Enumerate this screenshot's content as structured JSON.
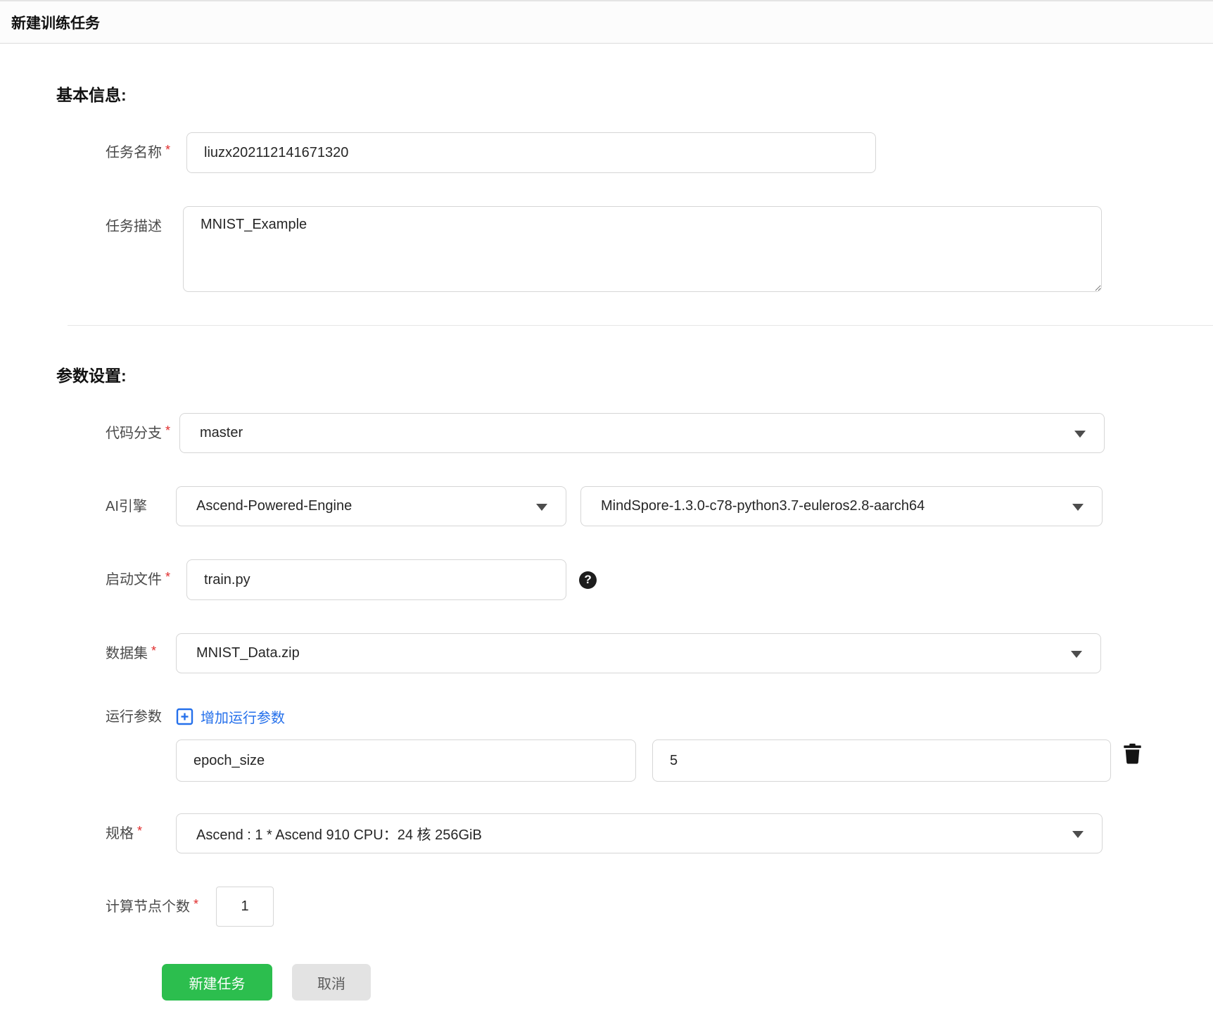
{
  "header": {
    "title": "新建训练任务"
  },
  "basic_section": {
    "heading": "基本信息:",
    "task_name": {
      "label": "任务名称",
      "required_mark": "*",
      "value": "liuzx202112141671320"
    },
    "task_desc": {
      "label": "任务描述",
      "value": "MNIST_Example"
    }
  },
  "params_section": {
    "heading": "参数设置:",
    "code_branch": {
      "label": "代码分支",
      "required_mark": "*",
      "value": "master"
    },
    "ai_engine": {
      "label": "AI引擎",
      "engine": "Ascend-Powered-Engine",
      "version": "MindSpore-1.3.0-c78-python3.7-euleros2.8-aarch64"
    },
    "boot_file": {
      "label": "启动文件",
      "required_mark": "*",
      "value": "train.py",
      "help_glyph": "?"
    },
    "dataset": {
      "label": "数据集",
      "required_mark": "*",
      "value": "MNIST_Data.zip"
    },
    "run_params": {
      "label": "运行参数",
      "add_label": "增加运行参数",
      "rows": [
        {
          "key": "epoch_size",
          "value": "5"
        }
      ]
    },
    "spec": {
      "label": "规格",
      "required_mark": "*",
      "value": "Ascend : 1 * Ascend 910 CPU：24 核 256GiB"
    },
    "node_count": {
      "label": "计算节点个数",
      "required_mark": "*",
      "value": "1"
    }
  },
  "actions": {
    "submit": "新建任务",
    "cancel": "取消"
  },
  "colors": {
    "primary_green": "#2cbe4e",
    "link_blue": "#2570eb",
    "required_red": "#e02b2b"
  }
}
